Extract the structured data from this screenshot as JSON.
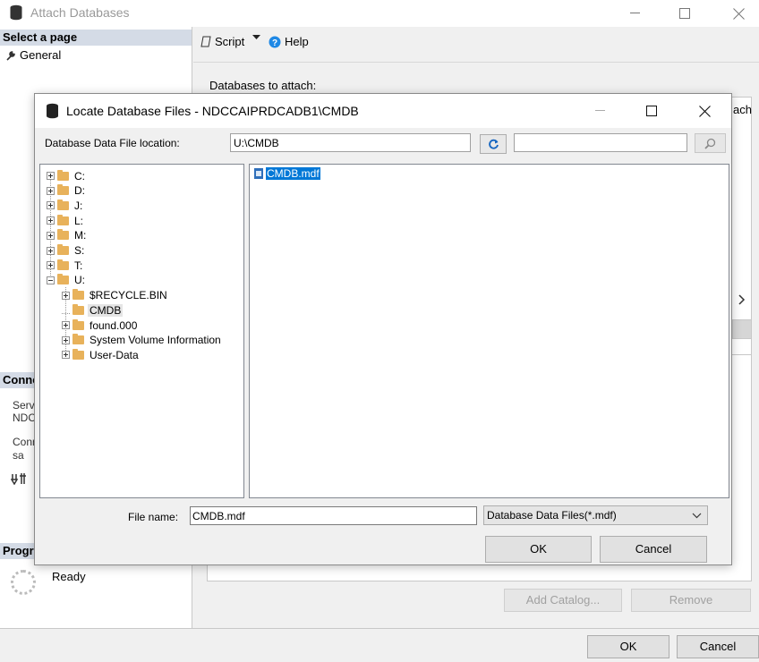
{
  "outer": {
    "title": "Attach Databases",
    "left_pane": {
      "select_page_header": "Select a page",
      "general_item": "General",
      "connection_header": "Conne",
      "server_label": "Serv",
      "server_value": "NDC",
      "connection_label": "Conn",
      "connection_value": "sa",
      "progress_header": "Progr",
      "status_text": "Ready"
    },
    "toolbar": {
      "script_label": "Script",
      "help_label": "Help"
    },
    "databases_to_attach_label": "Databases to attach:",
    "grid_partial_label": "ach",
    "add_catalog_button": "Add Catalog...",
    "remove_button": "Remove",
    "ok_button": "OK",
    "cancel_button": "Cancel"
  },
  "dialog": {
    "title": "Locate Database Files - NDCCAIPRDCADB1\\CMDB",
    "location_label": "Database Data File location:",
    "location_value": "U:\\CMDB",
    "search_value": "",
    "tree": [
      {
        "label": "C:",
        "level": 0,
        "expander": "plus"
      },
      {
        "label": "D:",
        "level": 0,
        "expander": "plus"
      },
      {
        "label": "J:",
        "level": 0,
        "expander": "plus"
      },
      {
        "label": "L:",
        "level": 0,
        "expander": "plus"
      },
      {
        "label": "M:",
        "level": 0,
        "expander": "plus"
      },
      {
        "label": "S:",
        "level": 0,
        "expander": "plus"
      },
      {
        "label": "T:",
        "level": 0,
        "expander": "plus"
      },
      {
        "label": "U:",
        "level": 0,
        "expander": "minus"
      },
      {
        "label": "$RECYCLE.BIN",
        "level": 1,
        "expander": "plus"
      },
      {
        "label": "CMDB",
        "level": 1,
        "expander": "none",
        "selected": true
      },
      {
        "label": "found.000",
        "level": 1,
        "expander": "plus"
      },
      {
        "label": "System Volume Information",
        "level": 1,
        "expander": "plus"
      },
      {
        "label": "User-Data",
        "level": 1,
        "expander": "plus"
      }
    ],
    "files": [
      {
        "name": "CMDB.mdf",
        "selected": true
      }
    ],
    "file_name_label": "File name:",
    "file_name_value": "CMDB.mdf",
    "file_type_selected": "Database Data Files(*.mdf)",
    "ok_button": "OK",
    "cancel_button": "Cancel"
  },
  "colors": {
    "selection": "#0078d7",
    "pane_header": "#d4dbe6",
    "folder": "#e8b25b",
    "help_icon": "#1e88e5"
  }
}
